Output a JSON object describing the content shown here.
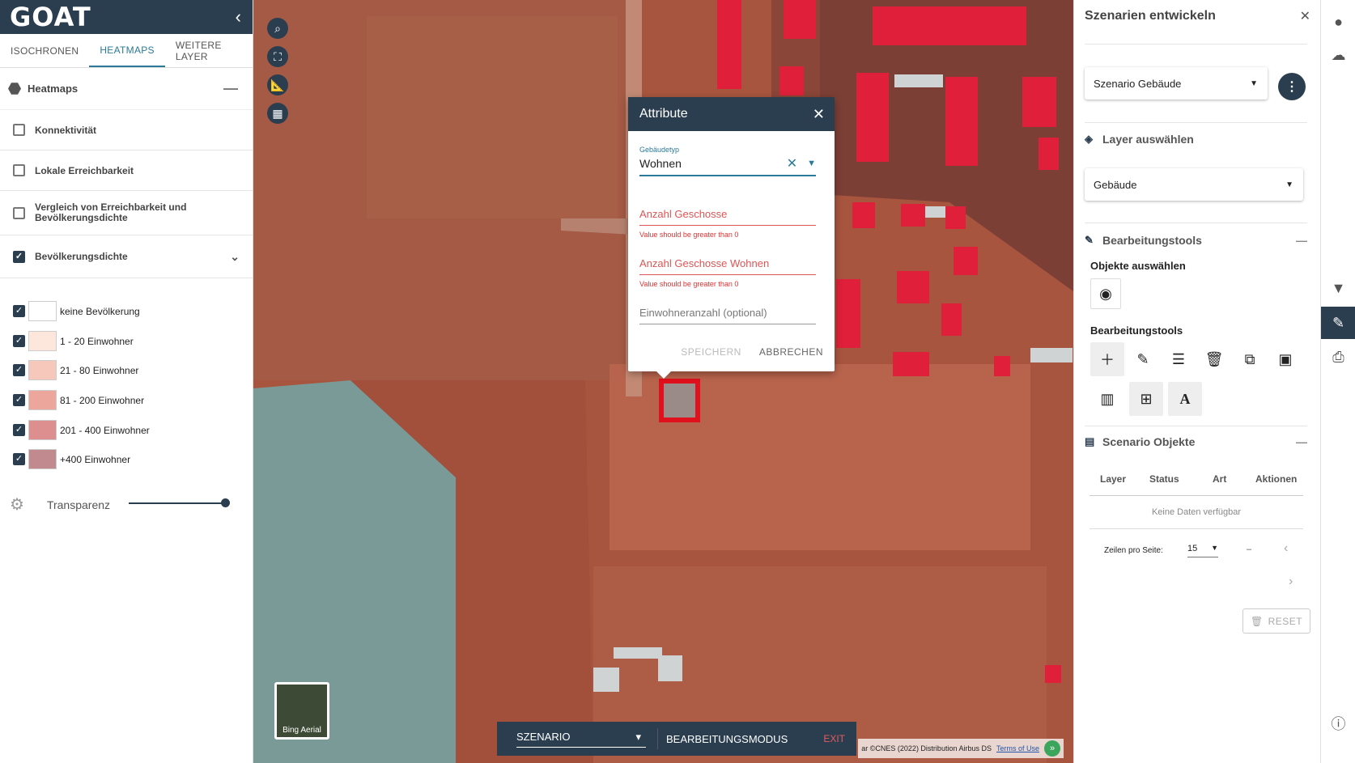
{
  "app": {
    "logo": "GOAT"
  },
  "left": {
    "tabs": [
      "ISOCHRONEN",
      "HEATMAPS",
      "WEITERE LAYER"
    ],
    "section_title": "Heatmaps",
    "layers": [
      {
        "label": "Konnektivität",
        "checked": false
      },
      {
        "label": "Lokale Erreichbarkeit",
        "checked": false
      },
      {
        "label": "Vergleich von Erreichbarkeit und Bevölkerungsdichte",
        "checked": false
      },
      {
        "label": "Bevölkerungsdichte",
        "checked": true
      }
    ],
    "legend": [
      {
        "label": "keine Bevölkerung",
        "color": "#ffffff"
      },
      {
        "label": "1 - 20 Einwohner",
        "color": "#fde6dc"
      },
      {
        "label": "21 - 80 Einwohner",
        "color": "#f6c7bb"
      },
      {
        "label": "81 - 200 Einwohner",
        "color": "#eda69b"
      },
      {
        "label": "201 - 400 Einwohner",
        "color": "#dd8f8f"
      },
      {
        "label": "+400 Einwohner",
        "color": "#c08a8e"
      }
    ],
    "transparency_label": "Transparenz",
    "transparency_value": 1.0
  },
  "map": {
    "basemap_label": "Bing Aerial",
    "attribution": "ar ©CNES (2022) Distribution Airbus DS",
    "terms": "Terms of Use",
    "bottom": {
      "scenario": "SZENARIO",
      "mode": "BEARBEITUNGSMODUS",
      "exit": "EXIT"
    }
  },
  "dialog": {
    "title": "Attribute",
    "gebaeudetyp_label": "Gebäudetyp",
    "gebaeudetyp_value": "Wohnen",
    "geschosse_placeholder": "Anzahl Geschosse",
    "geschosse_error": "Value should be greater than 0",
    "geschosse_wohnen_placeholder": "Anzahl Geschosse Wohnen",
    "geschosse_wohnen_error": "Value should be greater than 0",
    "einwohner_placeholder": "Einwohneranzahl (optional)",
    "save": "SPEICHERN",
    "cancel": "ABBRECHEN"
  },
  "right": {
    "title": "Szenarien entwickeln",
    "scenario_select": "Szenario Gebäude",
    "layer_section": "Layer auswählen",
    "layer_select": "Gebäude",
    "tools_section": "Bearbeitungstools",
    "select_objects": "Objekte auswählen",
    "tools_sub": "Bearbeitungstools",
    "objects_section": "Scenario Objekte",
    "columns": [
      "Layer",
      "Status",
      "Art",
      "Aktionen"
    ],
    "empty": "Keine Daten verfügbar",
    "rows_per_page_label": "Zeilen pro Seite:",
    "rows_per_page": "15",
    "page_info": "–",
    "reset": "RESET"
  }
}
